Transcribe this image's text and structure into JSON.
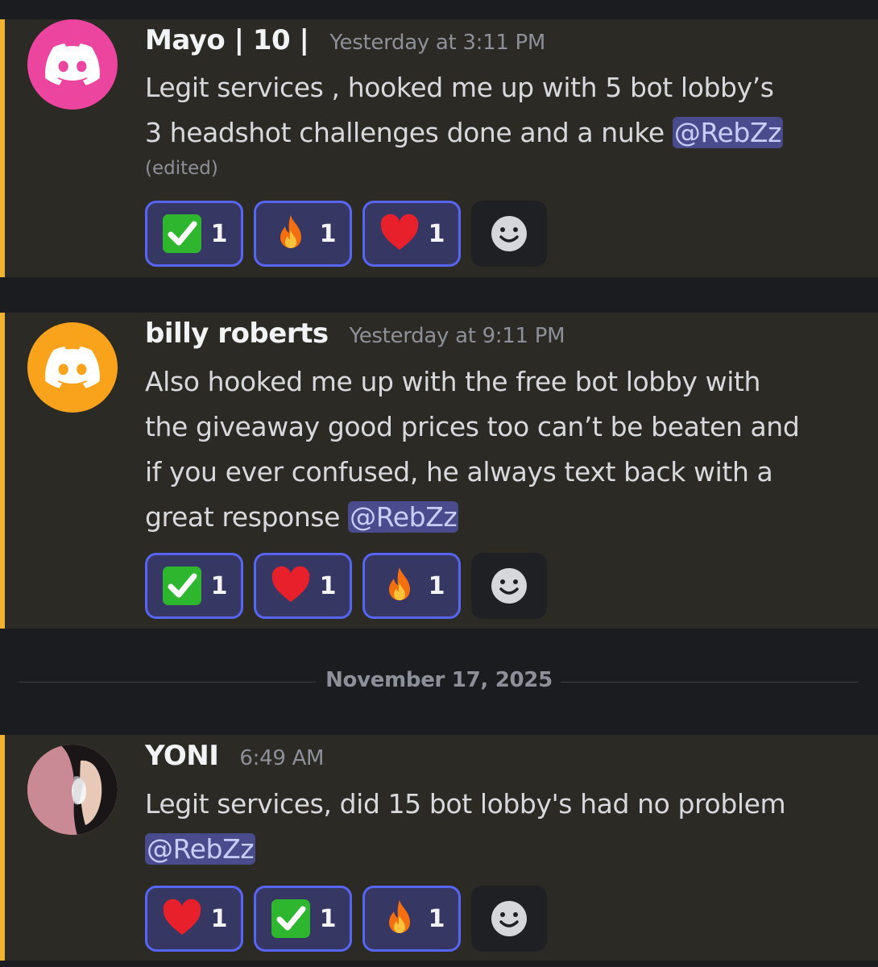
{
  "messages": [
    {
      "username": "Mayo | 10 |",
      "timestamp": "Yesterday at 3:11 PM",
      "text_lines": [
        "Legit services , hooked me up with 5 bot lobby’s",
        "3 headshot challenges done and a nuke "
      ],
      "mention": "@RebZz",
      "edited": "(edited)",
      "avatar_color": "#eb459f",
      "reactions": [
        {
          "emoji": "check-mark-icon",
          "count": "1"
        },
        {
          "emoji": "fire-icon",
          "count": "1"
        },
        {
          "emoji": "heart-icon",
          "count": "1"
        }
      ]
    },
    {
      "username": "billy roberts",
      "timestamp": "Yesterday at 9:11 PM",
      "text_lines": [
        "Also hooked me up with the free bot lobby with",
        "the giveaway good prices too can’t be beaten and",
        "if you ever confused, he always text back with a",
        "great response "
      ],
      "mention": "@RebZz",
      "avatar_color": "#f9a21c",
      "reactions": [
        {
          "emoji": "check-mark-icon",
          "count": "1"
        },
        {
          "emoji": "heart-icon",
          "count": "1"
        },
        {
          "emoji": "fire-icon",
          "count": "1"
        }
      ]
    },
    {
      "username": "YONI",
      "timestamp": "6:49 AM",
      "text_lines": [
        "Legit services, did 15 bot lobby's had no problem"
      ],
      "mention": "@RebZz",
      "reactions": [
        {
          "emoji": "heart-icon",
          "count": "1"
        },
        {
          "emoji": "check-mark-icon",
          "count": "1"
        },
        {
          "emoji": "fire-icon",
          "count": "1"
        }
      ]
    }
  ],
  "date_divider": "November 17, 2025",
  "colors": {
    "background": "#1b1c20",
    "message_bg": "#2c2a24",
    "highlight_bar": "#f0b232",
    "mention_bg": "#4a4b8c",
    "mention_text": "#c9cdfb",
    "reaction_bg": "#373764",
    "reaction_border": "#5865f2"
  }
}
